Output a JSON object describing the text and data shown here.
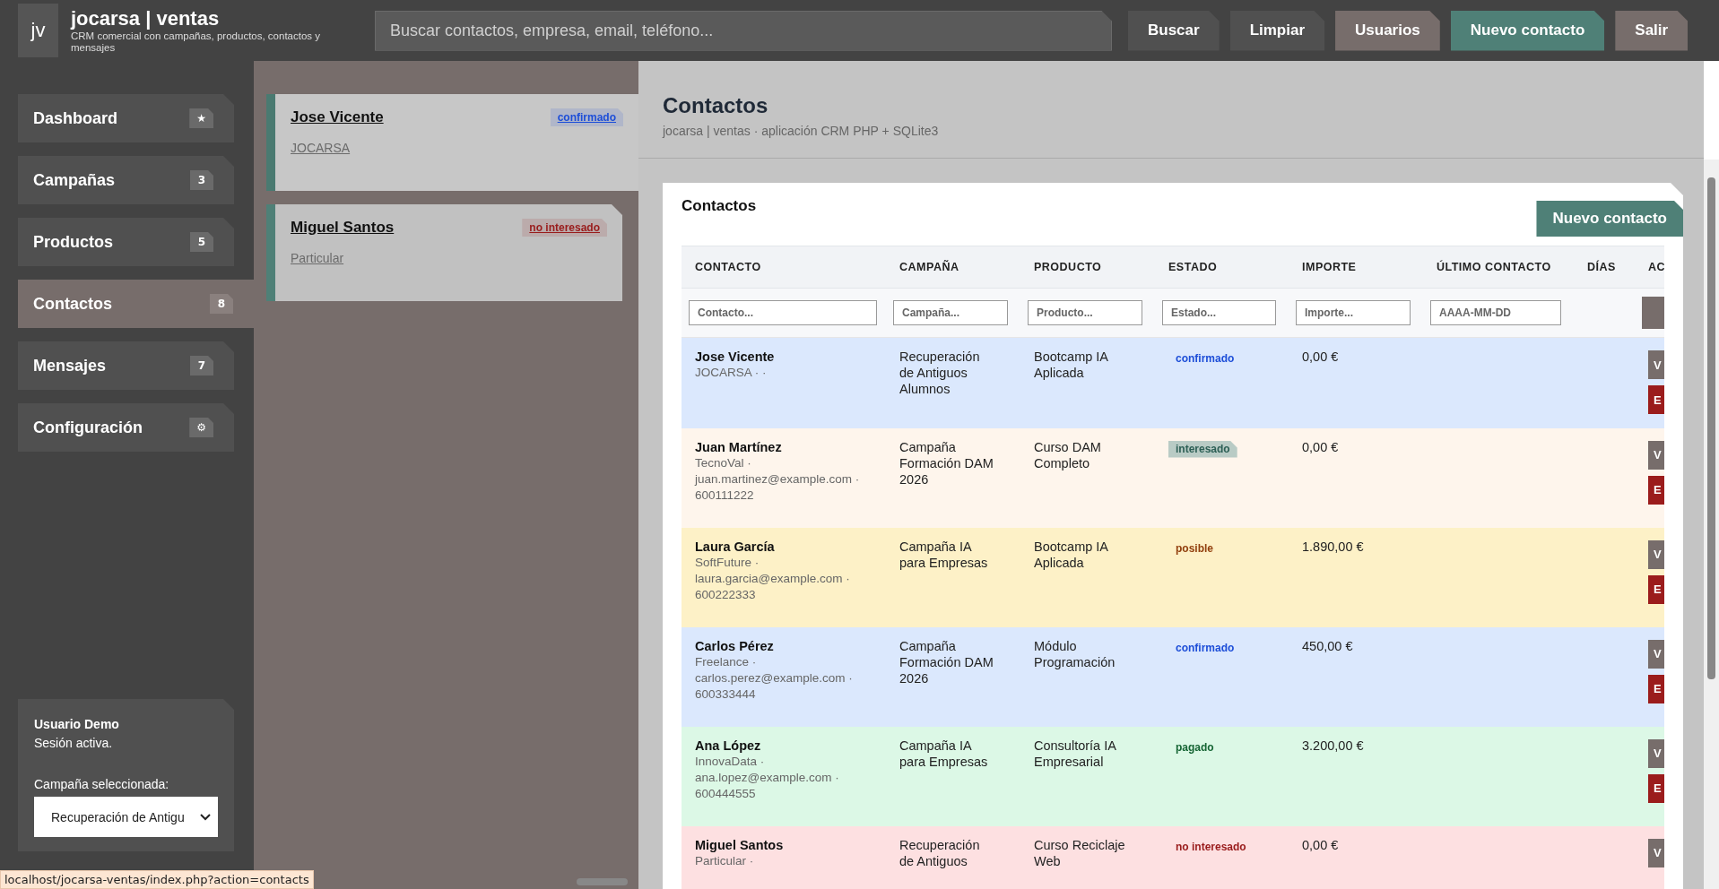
{
  "header": {
    "logo": "jv",
    "title": "jocarsa | ventas",
    "subtitle": "CRM comercial con campañas, productos, contactos y mensajes",
    "search": {
      "placeholder": "Buscar contactos, empresa, email, teléfono..."
    },
    "buttons": [
      {
        "label": "Buscar",
        "kind": "dark"
      },
      {
        "label": "Limpiar",
        "kind": "dark"
      },
      {
        "label": "Usuarios",
        "kind": "muted"
      },
      {
        "label": "Nuevo contacto",
        "kind": "primary"
      },
      {
        "label": "Salir",
        "kind": "muted"
      }
    ]
  },
  "sidebar": {
    "items": [
      {
        "label": "Dashboard",
        "badge": "★",
        "selected": false
      },
      {
        "label": "Campañas",
        "badge": "3",
        "selected": false
      },
      {
        "label": "Productos",
        "badge": "5",
        "selected": false
      },
      {
        "label": "Contactos",
        "badge": "8",
        "selected": true
      },
      {
        "label": "Mensajes",
        "badge": "7",
        "selected": false
      },
      {
        "label": "Configuración",
        "badge": "⚙",
        "selected": false
      }
    ],
    "user": {
      "name": "Usuario Demo",
      "status": "Sesión activa.",
      "select_label": "Campaña seleccionada:",
      "select_value": "Recuperación de Antigu"
    }
  },
  "contact_list": [
    {
      "name": "Jose Vicente",
      "company": "JOCARSA",
      "status": "confirmado",
      "color": "#1d4ed8",
      "selected": true
    },
    {
      "name": "Miguel Santos",
      "company": "Particular",
      "status": "no interesado",
      "color": "#991b1b",
      "selected": false
    }
  ],
  "page": {
    "title": "Contactos",
    "subtitle": "jocarsa | ventas · aplicación CRM PHP + SQLite3"
  },
  "table_card": {
    "title": "Contactos",
    "button": "Nuevo contacto",
    "columns": [
      "CONTACTO",
      "CAMPAÑA",
      "PRODUCTO",
      "ESTADO",
      "IMPORTE",
      "ÚLTIMO CONTACTO",
      "DÍAS",
      "AC"
    ],
    "filters": [
      {
        "placeholder": "Contacto..."
      },
      {
        "placeholder": "Campaña..."
      },
      {
        "placeholder": "Producto..."
      },
      {
        "placeholder": "Estado..."
      },
      {
        "placeholder": "Importe..."
      },
      {
        "placeholder": "AAAA-MM-DD"
      }
    ],
    "rows": [
      {
        "name": "Jose Vicente",
        "detail": "JOCARSA · ·",
        "campaign": "Recuperación de Antiguos Alumnos",
        "product": "Bootcamp IA Aplicada",
        "status": {
          "label": "confirmado",
          "color": "#1d4ed8",
          "kind": "text"
        },
        "amount": "0,00 €",
        "color": "#dbe8fd",
        "actions": [
          {
            "label": "V",
            "kind": "view"
          },
          {
            "label": "E",
            "kind": "delete"
          }
        ]
      },
      {
        "name": "Juan Martínez",
        "detail": "TecnoVal · juan.martinez@example.com · 600111222",
        "campaign": "Campaña Formación DAM 2026",
        "product": "Curso DAM Completo",
        "status": {
          "label": "interesado",
          "color": "#2d5f55",
          "kind": "tag"
        },
        "amount": "0,00 €",
        "color": "#fef5ec",
        "actions": [
          {
            "label": "V",
            "kind": "view"
          },
          {
            "label": "E",
            "kind": "delete"
          }
        ]
      },
      {
        "name": "Laura García",
        "detail": "SoftFuture · laura.garcia@example.com · 600222333",
        "campaign": "Campaña IA para Empresas",
        "product": "Bootcamp IA Aplicada",
        "status": {
          "label": "posible",
          "color": "#92400e",
          "kind": "text"
        },
        "amount": "1.890,00 €",
        "color": "#fdf1c7",
        "actions": [
          {
            "label": "V",
            "kind": "view"
          },
          {
            "label": "E",
            "kind": "delete"
          }
        ]
      },
      {
        "name": "Carlos Pérez",
        "detail": "Freelance · carlos.perez@example.com · 600333444",
        "campaign": "Campaña Formación DAM 2026",
        "product": "Módulo Programación",
        "status": {
          "label": "confirmado",
          "color": "#1d4ed8",
          "kind": "text"
        },
        "amount": "450,00 €",
        "color": "#dbe8fd",
        "actions": [
          {
            "label": "V",
            "kind": "view"
          },
          {
            "label": "E",
            "kind": "delete"
          }
        ]
      },
      {
        "name": "Ana López",
        "detail": "InnovaData · ana.lopez@example.com · 600444555",
        "campaign": "Campaña IA para Empresas",
        "product": "Consultoría IA Empresarial",
        "status": {
          "label": "pagado",
          "color": "#166534",
          "kind": "text"
        },
        "amount": "3.200,00 €",
        "color": "#dcf8e6",
        "actions": [
          {
            "label": "V",
            "kind": "view"
          },
          {
            "label": "E",
            "kind": "delete"
          }
        ]
      },
      {
        "name": "Miguel Santos",
        "detail": "Particular ·",
        "campaign": "Recuperación de Antiguos",
        "product": "Curso Reciclaje Web",
        "status": {
          "label": "no interesado",
          "color": "#991b1b",
          "kind": "text"
        },
        "amount": "0,00 €",
        "color": "#fde0e1",
        "actions": [
          {
            "label": "V",
            "kind": "view"
          }
        ]
      }
    ]
  },
  "status_bar": {
    "url": "localhost/jocarsa-ventas/index.php?action=contacts"
  }
}
